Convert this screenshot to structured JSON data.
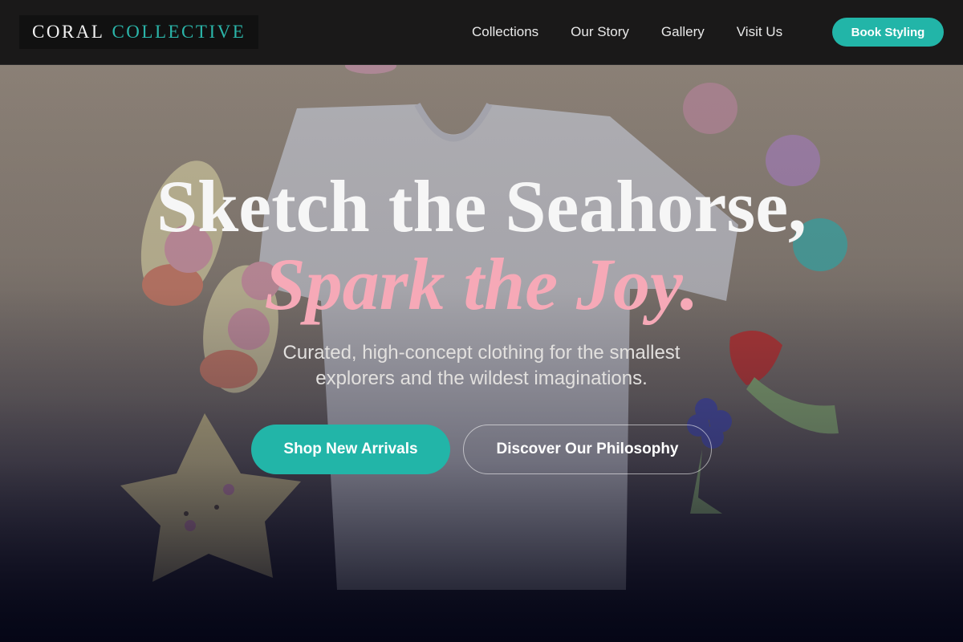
{
  "brand": {
    "part1": "CORAL",
    "part2": "COLLECTIVE"
  },
  "nav": {
    "items": [
      {
        "label": "Collections"
      },
      {
        "label": "Our Story"
      },
      {
        "label": "Gallery"
      },
      {
        "label": "Visit Us"
      }
    ],
    "cta_label": "Book Styling"
  },
  "hero": {
    "headline_line1": "Sketch the Seahorse,",
    "headline_line2": "Spark the Joy.",
    "subtitle": "Curated, high-concept clothing for the smallest explorers and the wildest imaginations.",
    "primary_button": "Shop New Arrivals",
    "secondary_button": "Discover Our Philosophy",
    "background_image": "flat-lay of baby t-shirt, bear socks, macarons, star pillow and fruit teethers"
  },
  "colors": {
    "accent": "#22b5a8",
    "headline_pink": "#f6a9b7",
    "navbar_bg": "#1a1919"
  }
}
